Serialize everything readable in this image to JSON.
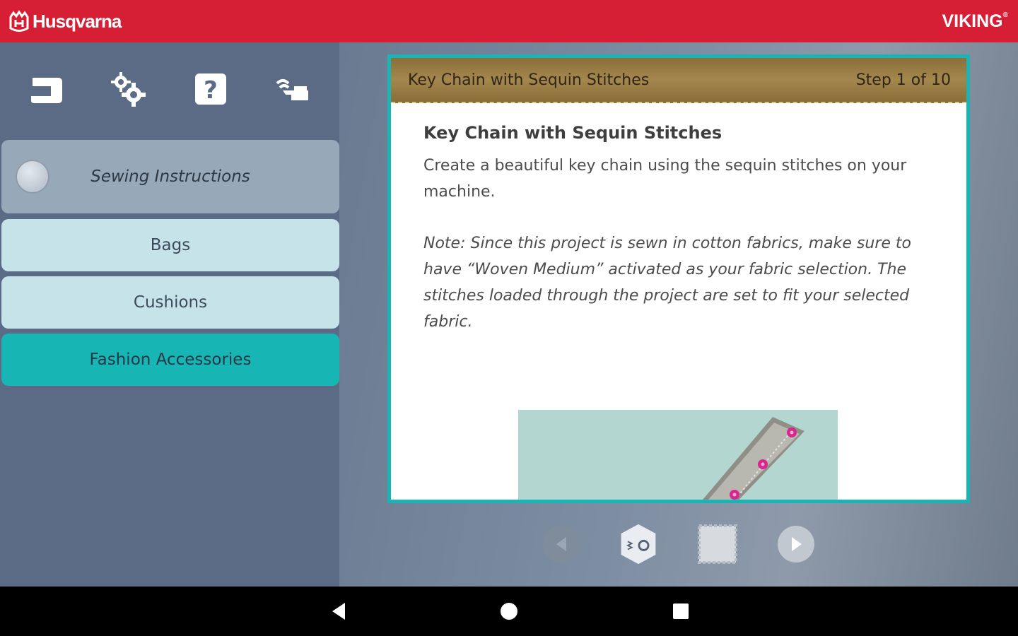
{
  "header": {
    "brand_left": "Husqvarna",
    "brand_right": "VIKING",
    "brand_right_mark": "®",
    "color": "#d61f35"
  },
  "toolbar": {
    "icons": [
      "sewing-mode-icon",
      "settings-icon",
      "help-icon",
      "wifi-machine-icon"
    ]
  },
  "menu": {
    "back_label": "Sewing Instructions",
    "items": [
      {
        "label": "Bags",
        "selected": false
      },
      {
        "label": "Cushions",
        "selected": false
      },
      {
        "label": "Fashion Accessories",
        "selected": true
      }
    ]
  },
  "card": {
    "header_title": "Key Chain with Sequin Stitches",
    "step": "Step 1 of 10",
    "title": "Key Chain with Sequin Stitches",
    "description": "Create a beautiful key chain using the sequin stitches on your machine.",
    "note": "Note: Since this project is sewn in cotton fabrics, make sure to have “Woven Medium” activated as your fabric selection. The stitches loaded through the project are set to fit your selected fabric."
  },
  "controls": {
    "icons": [
      "previous-step-icon",
      "stitch-settings-icon",
      "fabric-icon",
      "next-step-icon"
    ]
  },
  "navbar": {
    "icons": [
      "back-icon",
      "home-icon",
      "recents-icon"
    ]
  },
  "colors": {
    "accent": "#19b4b3",
    "panel": "#5b6b86",
    "card_header": "#a3874d"
  }
}
